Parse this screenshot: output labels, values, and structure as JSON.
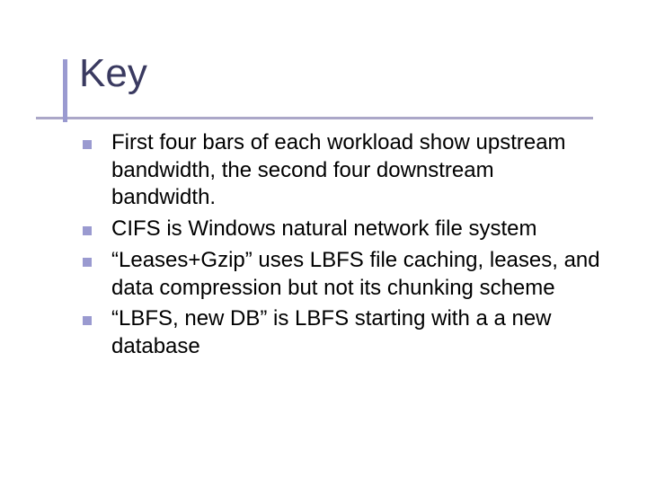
{
  "slide": {
    "title": "Key",
    "bullets": [
      "First four bars of each workload show upstream bandwidth, the second four downstream bandwidth.",
      "CIFS is Windows natural network file system",
      "“Leases+Gzip” uses LBFS file caching, leases, and data compression but not its chunking scheme",
      "“LBFS, new DB” is LBFS starting with a a new database"
    ]
  }
}
